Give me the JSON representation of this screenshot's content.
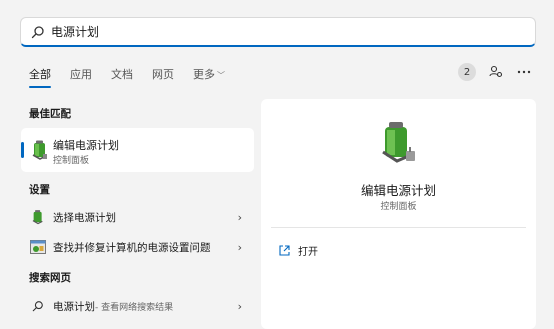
{
  "search": {
    "query": "电源计划",
    "icon": "search-icon"
  },
  "tabs": [
    {
      "label": "全部",
      "active": true
    },
    {
      "label": "应用"
    },
    {
      "label": "文档"
    },
    {
      "label": "网页"
    },
    {
      "label": "更多"
    }
  ],
  "header_right": {
    "badge_count": "2",
    "icons": [
      "switch-account-icon",
      "more-options-icon"
    ]
  },
  "sections": {
    "best_match": "最佳匹配",
    "settings": "设置",
    "web": "搜索网页"
  },
  "best_match": {
    "name": "编辑电源计划",
    "sub": "控制面板",
    "icon": "power-plan-icon"
  },
  "settings_items": [
    {
      "label": "选择电源计划",
      "icon": "power-plan-icon"
    },
    {
      "label": "查找并修复计算机的电源设置问题",
      "icon": "troubleshoot-icon"
    }
  ],
  "web_item": {
    "label": "电源计划",
    "sub": " - 查看网络搜索结果",
    "icon": "search-icon"
  },
  "detail": {
    "name": "编辑电源计划",
    "sub": "控制面板",
    "action": "打开",
    "action_icon": "open-external-icon"
  },
  "colors": {
    "accent": "#0067c0",
    "background": "#f3f3f3"
  }
}
